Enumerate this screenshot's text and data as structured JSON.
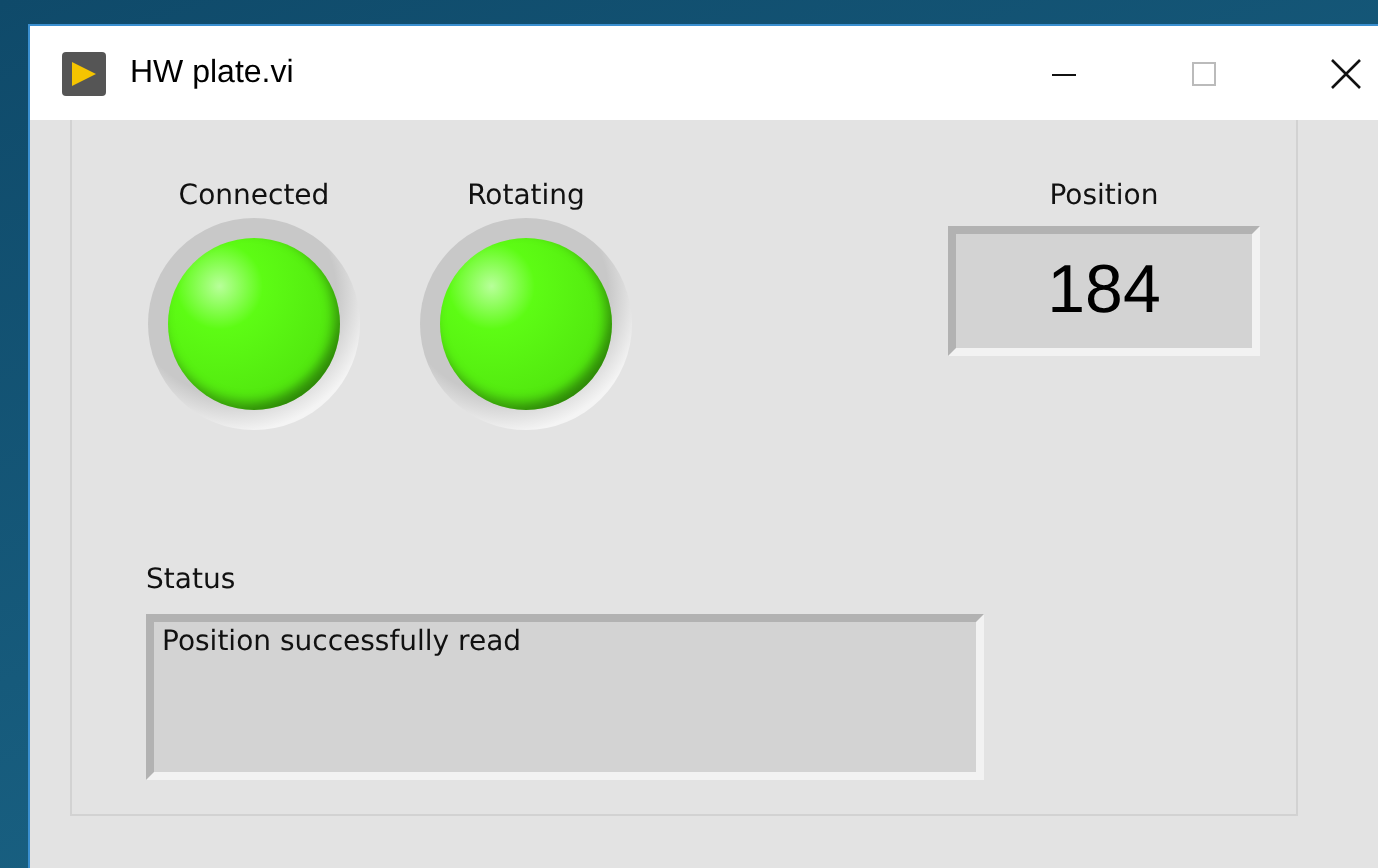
{
  "window": {
    "title": "HW plate.vi"
  },
  "indicators": [
    {
      "label": "Connected",
      "on": true
    },
    {
      "label": "Rotating",
      "on": true
    }
  ],
  "position": {
    "label": "Position",
    "value": "184"
  },
  "status": {
    "label": "Status",
    "value": "Position successfully read"
  }
}
